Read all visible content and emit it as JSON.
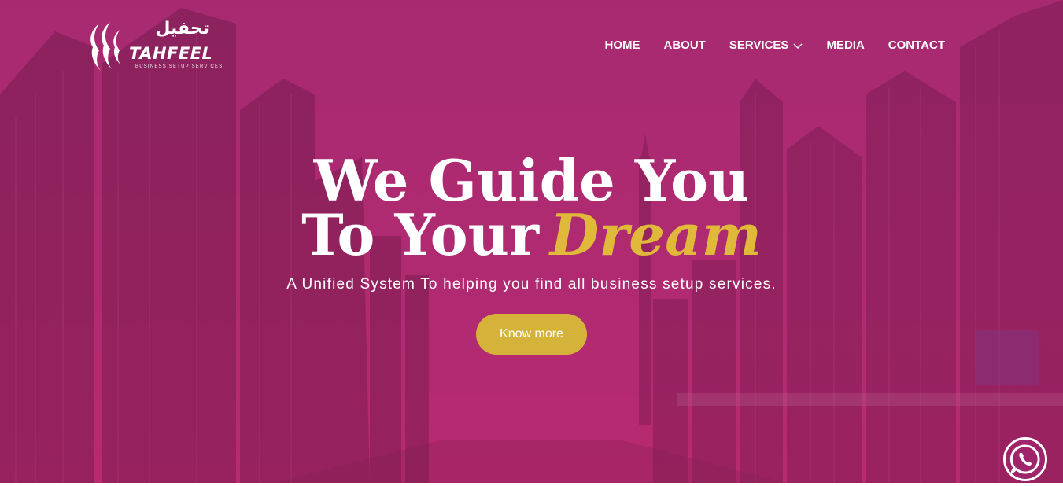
{
  "brand": {
    "arabic_name": "تحفيل",
    "name": "TAHFEEL",
    "tagline": "BUSINESS SETUP SERVICES"
  },
  "nav": {
    "items": [
      {
        "label": "HOME"
      },
      {
        "label": "ABOUT"
      },
      {
        "label": "SERVICES",
        "has_dropdown": true
      },
      {
        "label": "MEDIA"
      },
      {
        "label": "CONTACT"
      }
    ]
  },
  "hero": {
    "headline_line1": "We Guide You",
    "headline_line2_prefix": "To Your",
    "headline_highlight": "Dream",
    "subtitle": "A Unified System To helping you find all business setup services.",
    "cta_label": "Know more"
  },
  "floating": {
    "whatsapp_icon": "whatsapp-icon"
  },
  "colors": {
    "overlay": "#b02a72",
    "accent_gold": "#d5b23a",
    "text": "#ffffff"
  }
}
